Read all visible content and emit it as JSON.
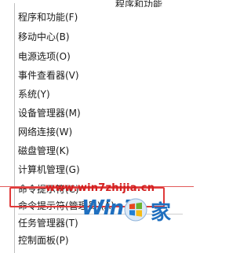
{
  "menu": {
    "top_partial": "程序和功能",
    "items": [
      {
        "label": "程序和功能(F)"
      },
      {
        "label": "移动中心(B)"
      },
      {
        "label": "电源选项(O)"
      },
      {
        "label": "事件查看器(V)"
      },
      {
        "label": "系统(Y)"
      },
      {
        "label": "设备管理器(M)"
      },
      {
        "label": "网络连接(W)"
      },
      {
        "label": "磁盘管理(K)"
      },
      {
        "label": "计算机管理(G)"
      },
      {
        "label": "命令提示符(C)"
      },
      {
        "label": "命令提示符(管理员)(A)"
      },
      {
        "label": "任务管理器(T)"
      },
      {
        "label": "控制面板(P)"
      }
    ]
  },
  "watermark": {
    "url": "www.win7zhijia.cn",
    "logo_text": "Win7",
    "logo_suffix": "家"
  },
  "colors": {
    "highlight_border": "#e03a3a",
    "watermark_blue": "#1f6fbf",
    "watermark_red": "#d32020"
  }
}
